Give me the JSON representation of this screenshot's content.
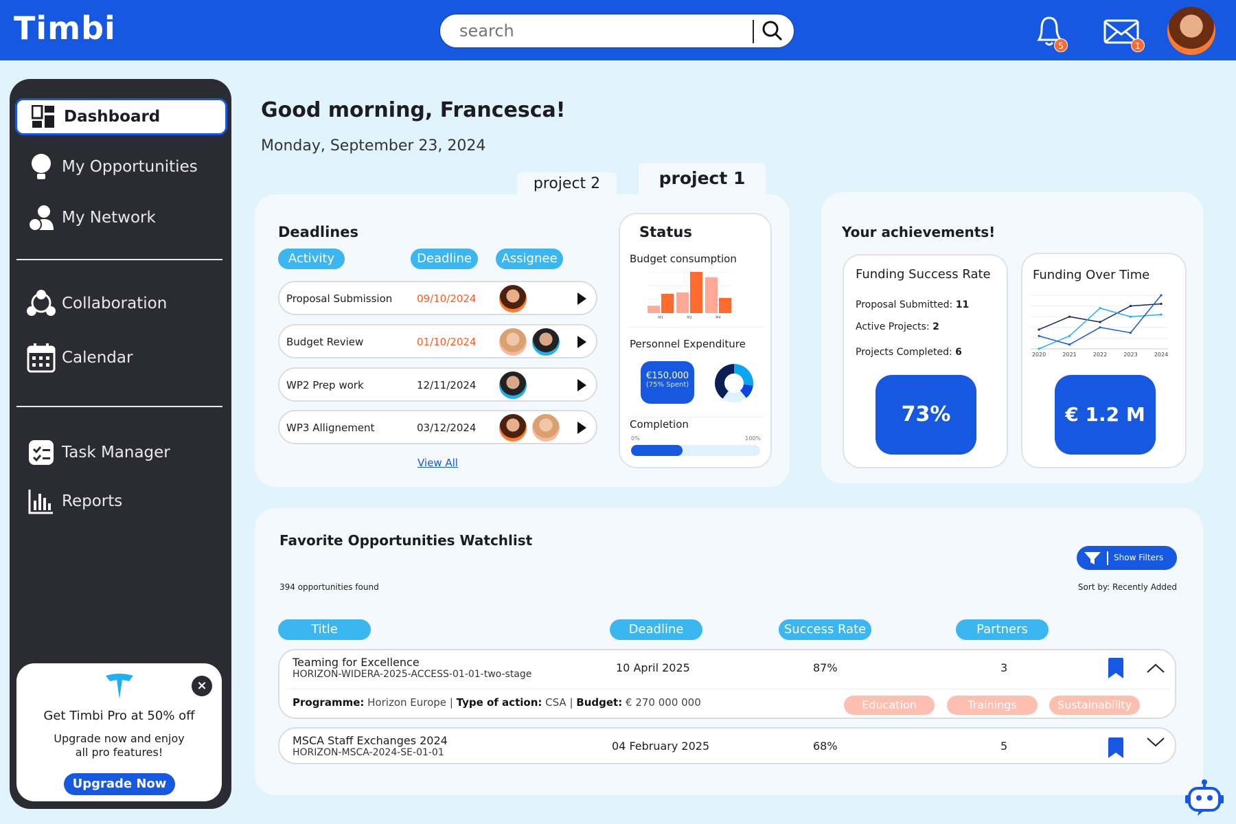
{
  "header": {
    "logo": "Timbi",
    "search_placeholder": "search",
    "notifications_count": "5",
    "messages_count": "1"
  },
  "sidebar": {
    "items": [
      {
        "label": "Dashboard",
        "icon": "dashboard-icon",
        "active": true
      },
      {
        "label": "My Opportunities",
        "icon": "lightbulb-icon"
      },
      {
        "label": "My Network",
        "icon": "network-icon"
      },
      {
        "label": "Collaboration",
        "icon": "collaboration-icon"
      },
      {
        "label": "Calendar",
        "icon": "calendar-icon"
      },
      {
        "label": "Task Manager",
        "icon": "task-icon"
      },
      {
        "label": "Reports",
        "icon": "reports-icon"
      }
    ],
    "promo": {
      "title": "Get Timbi Pro at 50% off",
      "text1": "Upgrade now and enjoy",
      "text2": "all pro features!",
      "button": "Upgrade Now"
    }
  },
  "greeting": "Good morning, Francesca!",
  "date": "Monday, September 23, 2024",
  "tabs": [
    "project 2",
    "project 1"
  ],
  "deadlines": {
    "title": "Deadlines",
    "headers": [
      "Activity",
      "Deadline",
      "Assignee"
    ],
    "rows": [
      {
        "activity": "Proposal Submission",
        "deadline": "09/10/2024",
        "overdue": true,
        "assignees": 1
      },
      {
        "activity": "Budget Review",
        "deadline": "01/10/2024",
        "overdue": true,
        "assignees": 2
      },
      {
        "activity": "WP2 Prep work",
        "deadline": "12/11/2024",
        "overdue": false,
        "assignees": 1
      },
      {
        "activity": "WP3 Allignement",
        "deadline": "03/12/2024",
        "overdue": false,
        "assignees": 2
      }
    ],
    "view_all": "View All"
  },
  "status": {
    "title": "Status",
    "budget_title": "Budget consumption",
    "budget_chart": {
      "type": "bar",
      "categories": [
        "M1",
        "M2",
        "M4"
      ],
      "series": [
        {
          "values": [
            0.18,
            0.5,
            0.87
          ]
        },
        {
          "values": [
            0.47,
            1.0,
            0.37
          ]
        }
      ],
      "colors": [
        "#ffa895",
        "#ff6a2f"
      ]
    },
    "personnel_title": "Personnel Expenditure",
    "personnel_amount": "€150,000",
    "personnel_spent": "(75% Spent)",
    "donut": {
      "type": "pie",
      "values": [
        27,
        12,
        21,
        40
      ],
      "colors": [
        "#0aa7f0",
        "#0d45e0",
        "#dff1fc",
        "#0b1e55"
      ]
    },
    "completion_title": "Completion",
    "completion_min": "0%",
    "completion_max": "100%",
    "completion_value": 40
  },
  "achievements": {
    "title": "Your achievements!",
    "success": {
      "title": "Funding Success Rate",
      "lines": [
        {
          "label": "Proposal Submitted: ",
          "value": "11"
        },
        {
          "label": "Active Projects: ",
          "value": "2"
        },
        {
          "label": "Projects Completed: ",
          "value": "6"
        }
      ],
      "rate": "73%"
    },
    "funding": {
      "title": "Funding Over Time",
      "total": "€ 1.2 M",
      "chart_data": {
        "type": "line",
        "x": [
          "2020",
          "2021",
          "2022",
          "2023",
          "2024"
        ],
        "series": [
          {
            "values": [
              1.8,
              3.0,
              2.5,
              4.0,
              4.2
            ],
            "color": "#13275e"
          },
          {
            "values": [
              0,
              1.2,
              3.8,
              3.0,
              3.2
            ],
            "color": "#1eb0f5"
          },
          {
            "values": [
              1.2,
              0.4,
              2.0,
              1.5,
              5.0
            ],
            "color": "#1659e0"
          }
        ],
        "ylim": [
          0,
          5
        ],
        "grid": true
      }
    }
  },
  "watchlist": {
    "title": "Favorite Opportunities Watchlist",
    "found": "394 opportunities found",
    "filters": "Show Filters",
    "sort": "Sort by: Recently Added",
    "headers": [
      "Title",
      "Deadline",
      "Success Rate",
      "Partners"
    ],
    "rows": [
      {
        "title": "Teaming for Excellence",
        "code": "HORIZON-WIDERA-2025-ACCESS-01-01-two-stage",
        "deadline": "10 April 2025",
        "rate": "87%",
        "partners": "3",
        "expanded": true,
        "programme_label": "Programme:",
        "programme": "Horizon Europe",
        "action_label": "Type of action:",
        "action": "CSA",
        "budget_label": "Budget:",
        "budget": "€ 270 000 000",
        "tags": [
          "Education",
          "Trainings",
          "Sustainability"
        ]
      },
      {
        "title": "MSCA Staff Exchanges 2024",
        "code": "HORIZON-MSCA-2024-SE-01-01",
        "deadline": "04 February 2025",
        "rate": "68%",
        "partners": "5",
        "expanded": false
      }
    ]
  }
}
